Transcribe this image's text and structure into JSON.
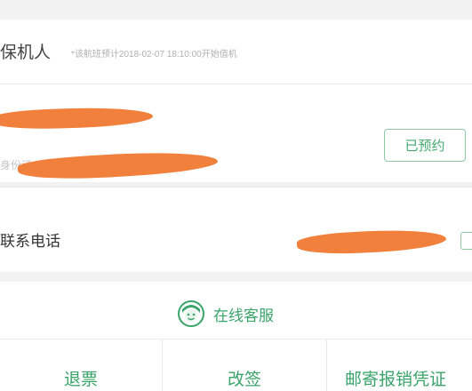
{
  "robot": {
    "title": "保机人",
    "note": "*该航班预计2018-02-07 18:10:00开始值机"
  },
  "passenger": {
    "id_label": "身份证",
    "status_button": "已预约"
  },
  "contact": {
    "label": "联系电话"
  },
  "service": {
    "label": "在线客服",
    "icon": "customer-service-icon"
  },
  "actions": [
    {
      "label": "退票"
    },
    {
      "label": "改签"
    },
    {
      "label": "邮寄报销凭证"
    }
  ],
  "colors": {
    "accent_green": "#3aa46a",
    "redaction_orange": "#f0803c"
  }
}
